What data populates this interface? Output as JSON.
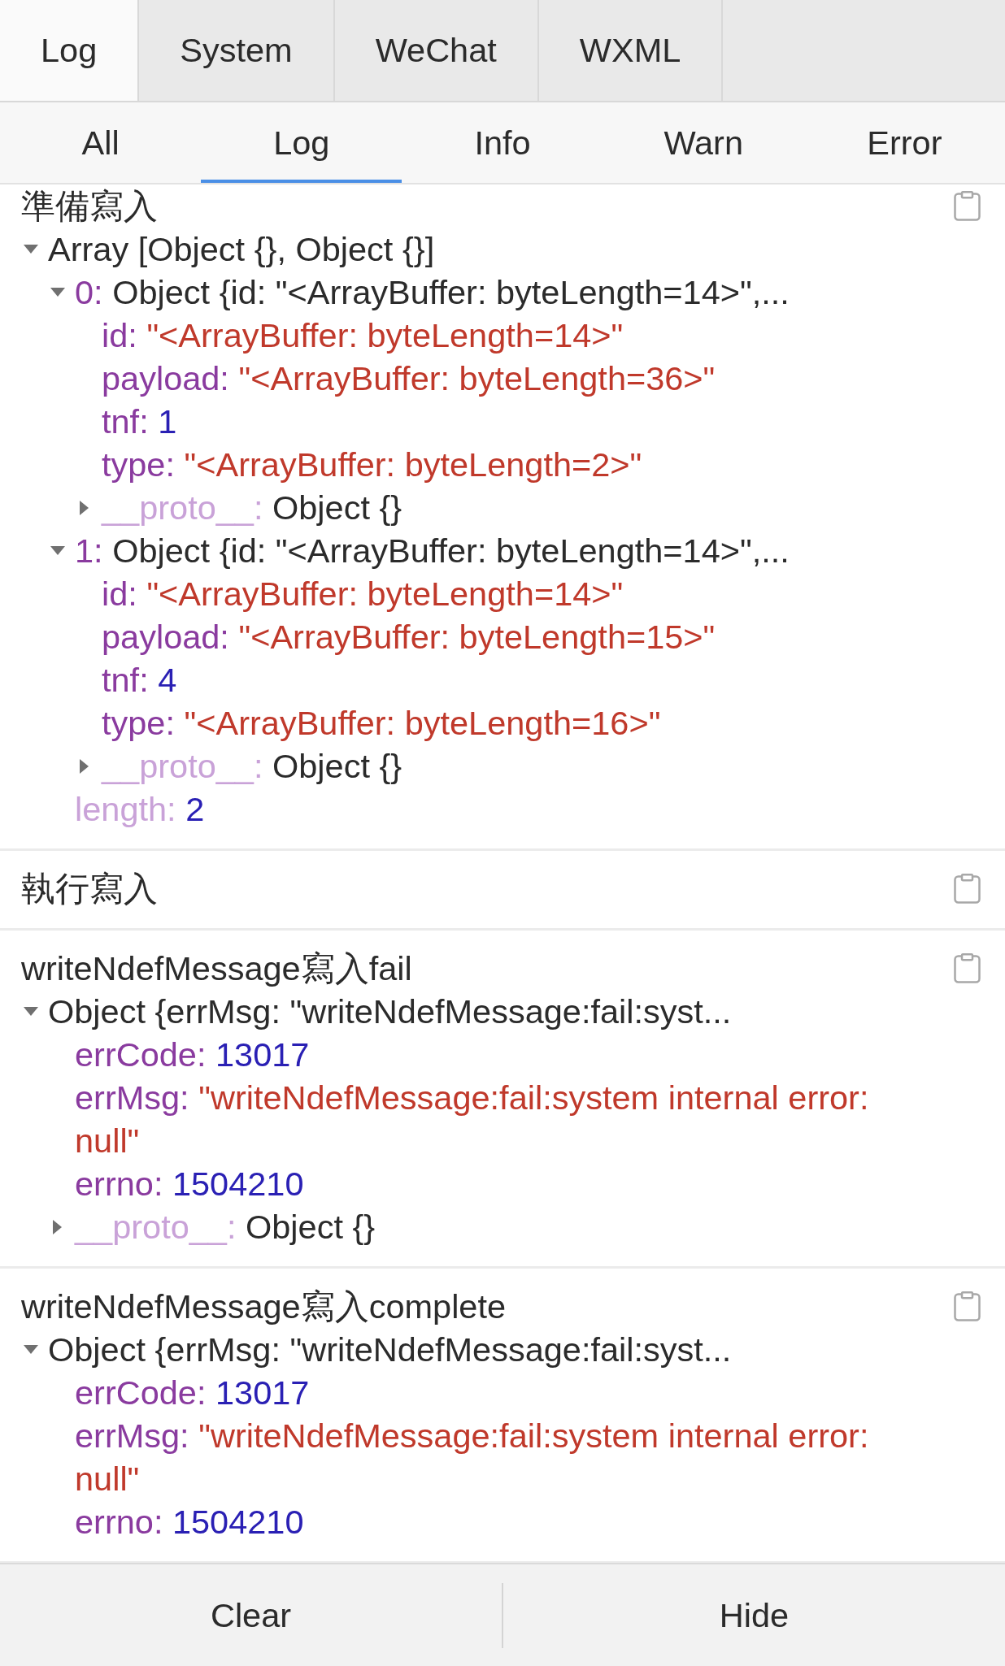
{
  "top_tabs": [
    {
      "label": "Log",
      "selected": true
    },
    {
      "label": "System",
      "selected": false
    },
    {
      "label": "WeChat",
      "selected": false
    },
    {
      "label": "WXML",
      "selected": false
    }
  ],
  "filter_tabs": [
    {
      "label": "All",
      "selected": false
    },
    {
      "label": "Log",
      "selected": true
    },
    {
      "label": "Info",
      "selected": false
    },
    {
      "label": "Warn",
      "selected": false
    },
    {
      "label": "Error",
      "selected": false
    }
  ],
  "entries": [
    {
      "message": "準備寫入",
      "tree": [
        {
          "kind": "object",
          "expanded": true,
          "value": "Array [Object {}, Object {}]",
          "children": [
            {
              "key": "0:",
              "kind": "object",
              "expanded": true,
              "faded": false,
              "value": "Object {id: \"<ArrayBuffer: byteLength=14>\",...",
              "children": [
                {
                  "key": "id:",
                  "kind": "string",
                  "faded": false,
                  "value": "\"<ArrayBuffer: byteLength=14>\""
                },
                {
                  "key": "payload:",
                  "kind": "string",
                  "faded": false,
                  "value": "\"<ArrayBuffer: byteLength=36>\""
                },
                {
                  "key": "tnf:",
                  "kind": "number",
                  "faded": false,
                  "value": "1"
                },
                {
                  "key": "type:",
                  "kind": "string",
                  "faded": false,
                  "value": "\"<ArrayBuffer: byteLength=2>\""
                },
                {
                  "key": "__proto__:",
                  "kind": "object",
                  "expanded": false,
                  "faded": true,
                  "value": "Object {}"
                }
              ]
            },
            {
              "key": "1:",
              "kind": "object",
              "expanded": true,
              "faded": false,
              "value": "Object {id: \"<ArrayBuffer: byteLength=14>\",...",
              "children": [
                {
                  "key": "id:",
                  "kind": "string",
                  "faded": false,
                  "value": "\"<ArrayBuffer: byteLength=14>\""
                },
                {
                  "key": "payload:",
                  "kind": "string",
                  "faded": false,
                  "value": "\"<ArrayBuffer: byteLength=15>\""
                },
                {
                  "key": "tnf:",
                  "kind": "number",
                  "faded": false,
                  "value": "4"
                },
                {
                  "key": "type:",
                  "kind": "string",
                  "faded": false,
                  "value": "\"<ArrayBuffer: byteLength=16>\""
                },
                {
                  "key": "__proto__:",
                  "kind": "object",
                  "expanded": false,
                  "faded": true,
                  "value": "Object {}"
                }
              ]
            },
            {
              "key": "length:",
              "kind": "number",
              "faded": true,
              "value": "2"
            }
          ]
        }
      ]
    },
    {
      "message": "執行寫入"
    },
    {
      "message": "writeNdefMessage寫入fail",
      "tree": [
        {
          "kind": "object",
          "expanded": true,
          "value": "Object {errMsg: \"writeNdefMessage:fail:syst...",
          "children": [
            {
              "key": "errCode:",
              "kind": "number",
              "faded": false,
              "value": "13017"
            },
            {
              "key": "errMsg:",
              "kind": "string",
              "faded": false,
              "value": "\"writeNdefMessage:fail:system internal error: null\""
            },
            {
              "key": "errno:",
              "kind": "number",
              "faded": false,
              "value": "1504210"
            },
            {
              "key": "__proto__:",
              "kind": "object",
              "expanded": false,
              "faded": true,
              "value": "Object {}"
            }
          ]
        }
      ]
    },
    {
      "message": "writeNdefMessage寫入complete",
      "tree": [
        {
          "kind": "object",
          "expanded": true,
          "value": "Object {errMsg: \"writeNdefMessage:fail:syst...",
          "children": [
            {
              "key": "errCode:",
              "kind": "number",
              "faded": false,
              "value": "13017"
            },
            {
              "key": "errMsg:",
              "kind": "string",
              "faded": false,
              "value": "\"writeNdefMessage:fail:system internal error: null\""
            },
            {
              "key": "errno:",
              "kind": "number",
              "faded": false,
              "value": "1504210"
            }
          ]
        }
      ]
    }
  ],
  "footer_buttons": [
    {
      "label": "Clear"
    },
    {
      "label": "Hide"
    }
  ]
}
